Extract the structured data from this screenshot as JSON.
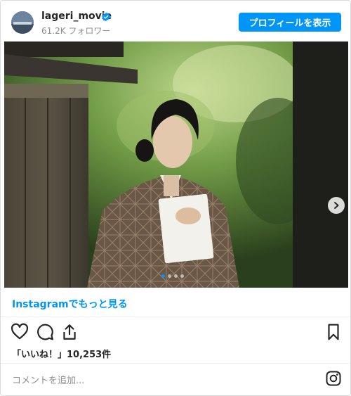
{
  "header": {
    "username": "lageri_movie",
    "followers": "61.2K フォロワー",
    "profile_button": "プロフィールを表示"
  },
  "post": {
    "view_more": "Instagramでもっと見る",
    "likes": "「いいね！」10,253件",
    "comment_placeholder": "コメントを追加...",
    "carousel_count": 4,
    "carousel_active": 0
  },
  "icons": [
    "verified-icon",
    "chevron-right-icon",
    "heart-icon",
    "comment-icon",
    "share-icon",
    "bookmark-icon",
    "instagram-icon"
  ],
  "colors": {
    "accent": "#0095f6",
    "text": "#262626",
    "muted": "#8e8e8e"
  }
}
